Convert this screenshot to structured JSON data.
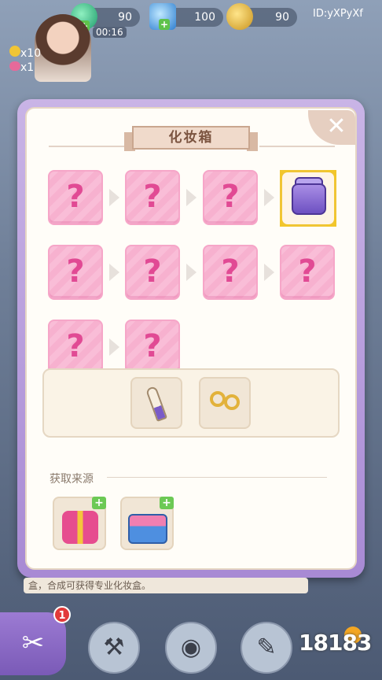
{
  "header": {
    "gems_value": "90",
    "gems_timer": "00:16",
    "diamonds_value": "100",
    "coins_value": "90",
    "player_id": "ID:yXPyXf"
  },
  "side_counters": {
    "item_a": "x10",
    "item_b": "x1"
  },
  "modal": {
    "title": "化妆箱",
    "close_label": "✕",
    "merge_chain": [
      {
        "label": "?"
      },
      {
        "label": "?"
      },
      {
        "label": "?"
      },
      {
        "label": "?"
      },
      {
        "label": "?"
      },
      {
        "label": "?"
      },
      {
        "label": "?"
      },
      {
        "label": "?"
      },
      {
        "label": "?"
      }
    ],
    "final_item_icon": "makeup-box-icon",
    "ingredients": [
      "lipstick-icon",
      "earrings-icon"
    ],
    "source_heading": "获取来源",
    "sources": [
      "gift-box-icon",
      "storage-box-icon"
    ]
  },
  "hint_text": "盒，合成可获得专业化妆盒。",
  "toolbar": {
    "notification_count": "1",
    "tools": [
      "scissors-comb-icon",
      "axe-icon",
      "iron-icon",
      "hairdryer-icon"
    ]
  },
  "watermark": "18183",
  "colors": {
    "modal_frame": "#b79de0",
    "slot_pink": "#f9bdd7",
    "question_mark": "#e14a94",
    "gold_highlight": "#f2c62a",
    "close_button": "#e6cfc1"
  }
}
